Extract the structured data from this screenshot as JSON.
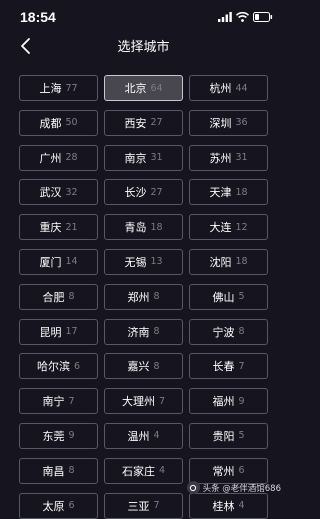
{
  "status_bar": {
    "time": "18:54"
  },
  "nav": {
    "title": "选择城市"
  },
  "cities": [
    {
      "name": "上海",
      "count": "77"
    },
    {
      "name": "北京",
      "count": "64"
    },
    {
      "name": "杭州",
      "count": "44"
    },
    {
      "name": "成都",
      "count": "50"
    },
    {
      "name": "西安",
      "count": "27"
    },
    {
      "name": "深圳",
      "count": "36"
    },
    {
      "name": "广州",
      "count": "28"
    },
    {
      "name": "南京",
      "count": "31"
    },
    {
      "name": "苏州",
      "count": "31"
    },
    {
      "name": "武汉",
      "count": "32"
    },
    {
      "name": "长沙",
      "count": "27"
    },
    {
      "name": "天津",
      "count": "18"
    },
    {
      "name": "重庆",
      "count": "21"
    },
    {
      "name": "青岛",
      "count": "18"
    },
    {
      "name": "大连",
      "count": "12"
    },
    {
      "name": "厦门",
      "count": "14"
    },
    {
      "name": "无锡",
      "count": "13"
    },
    {
      "name": "沈阳",
      "count": "18"
    },
    {
      "name": "合肥",
      "count": "8"
    },
    {
      "name": "郑州",
      "count": "8"
    },
    {
      "name": "佛山",
      "count": "5"
    },
    {
      "name": "昆明",
      "count": "17"
    },
    {
      "name": "济南",
      "count": "8"
    },
    {
      "name": "宁波",
      "count": "8"
    },
    {
      "name": "哈尔滨",
      "count": "6"
    },
    {
      "name": "嘉兴",
      "count": "8"
    },
    {
      "name": "长春",
      "count": "7"
    },
    {
      "name": "南宁",
      "count": "7"
    },
    {
      "name": "大理州",
      "count": "7"
    },
    {
      "name": "福州",
      "count": "9"
    },
    {
      "name": "东莞",
      "count": "9"
    },
    {
      "name": "温州",
      "count": "4"
    },
    {
      "name": "贵阳",
      "count": "5"
    },
    {
      "name": "南昌",
      "count": "8"
    },
    {
      "name": "石家庄",
      "count": "4"
    },
    {
      "name": "常州",
      "count": "6"
    },
    {
      "name": "太原",
      "count": "6"
    },
    {
      "name": "三亚",
      "count": "7"
    },
    {
      "name": "桂林",
      "count": "4"
    }
  ],
  "selected_index": 1,
  "watermark": {
    "text": "头条 @老伴酒馆686"
  }
}
